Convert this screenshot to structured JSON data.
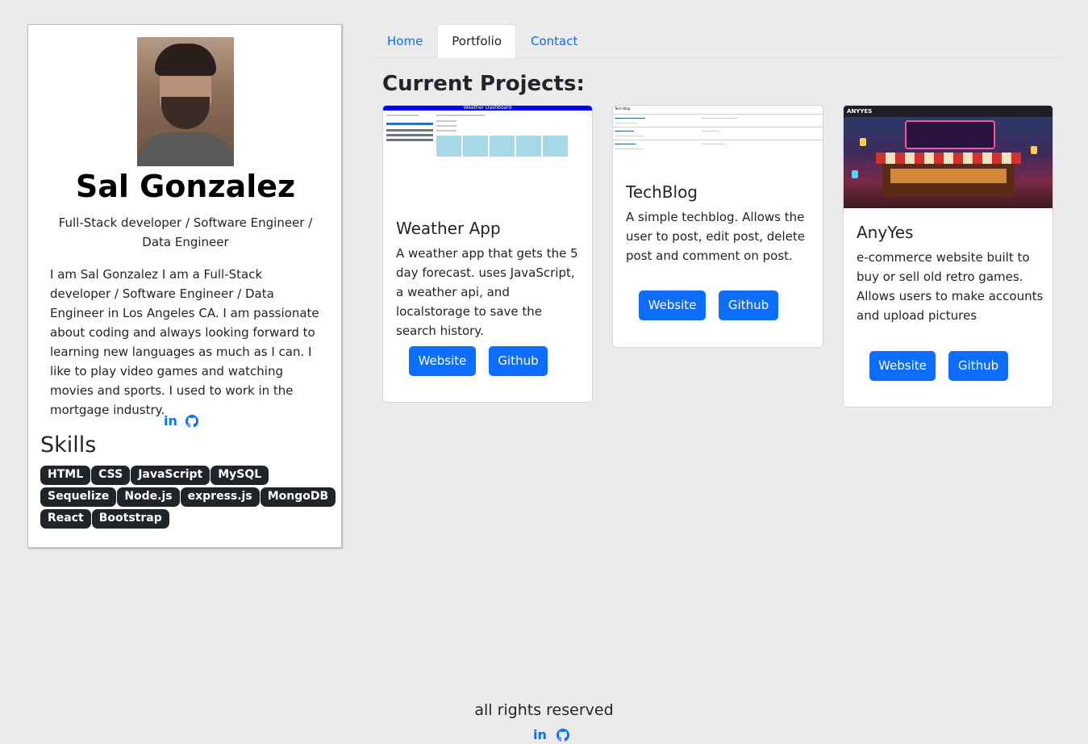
{
  "profile": {
    "name": "Sal Gonzalez",
    "role": "Full-Stack developer / Software Engineer / Data Engineer",
    "bio": "I am Sal Gonzalez I am a Full-Stack developer / Software Engineer / Data Engineer in Los Angeles CA. I am passionate about coding and always looking forward to learning new languages as much as I can. I like to play video games and watching movies and sports. I used to work in the mortgage industry.",
    "social": {
      "linkedin": "in",
      "linkedin_icon": "linkedin-icon",
      "github_icon": "github-icon"
    },
    "skills_title": "Skills",
    "skills": [
      "HTML",
      "CSS",
      "JavaScript",
      "MySQL",
      "Sequelize",
      "Node.js",
      "express.js",
      "MongoDB",
      "React",
      "Bootstrap"
    ]
  },
  "tabs": [
    {
      "label": "Home",
      "active": false
    },
    {
      "label": "Portfolio",
      "active": true
    },
    {
      "label": "Contact",
      "active": false
    }
  ],
  "section_title": "Current Projects:",
  "projects": [
    {
      "title": "Weather App",
      "description": "A weather app that gets the 5 day forecast. uses JavaScript, a weather api, and localstorage to save the search history.",
      "website_label": "Website",
      "github_label": "Github",
      "thumb_title": "Weather Dashboard"
    },
    {
      "title": "TechBlog",
      "description": "A simple techblog. Allows the user to post, edit post, delete post and comment on post.",
      "website_label": "Website",
      "github_label": "Github",
      "thumb_title": "Tech Blog"
    },
    {
      "title": "AnyYes",
      "description": "e-commerce website built to buy or sell old retro games. Allows users to make accounts and upload pictures",
      "website_label": "Website",
      "github_label": "Github",
      "thumb_title": "ANYYES"
    }
  ],
  "footer": {
    "text": "all rights reserved",
    "linkedin": "in"
  },
  "colors": {
    "accent": "#0d6efd",
    "badge": "#212529",
    "background": "#ebebeb"
  }
}
